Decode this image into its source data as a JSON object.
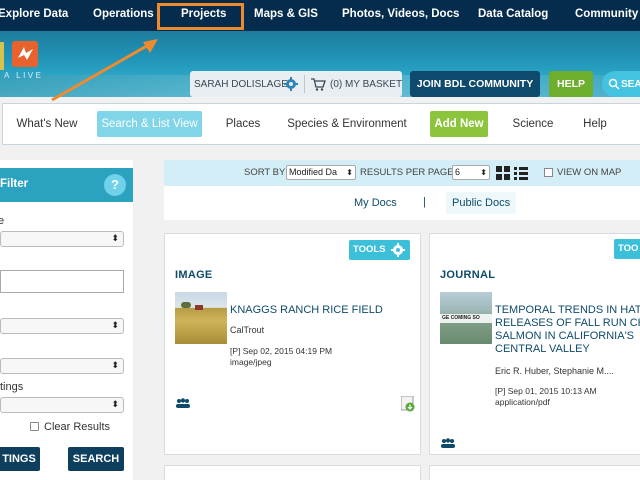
{
  "topnav": {
    "items": [
      "Explore Data",
      "Operations",
      "Projects",
      "Maps & GIS",
      "Photos, Videos, Docs",
      "Data Catalog",
      "Community"
    ]
  },
  "banner": {
    "logo_text": "A LIVE",
    "user_name": "SARAH DOLISLAGER",
    "basket": "(0) MY BASKET",
    "join_label": "JOIN BDL COMMUNITY",
    "help_label": "HELP",
    "search_label": "SEA"
  },
  "subnav": {
    "items": [
      "What's New",
      "Search & List View",
      "Places",
      "Species & Environment",
      "Add New",
      "Science",
      "Help"
    ]
  },
  "filter": {
    "title": "Filter",
    "help_glyph": "?",
    "labels": [
      "e",
      "",
      "",
      "",
      "tings"
    ],
    "clear_label": "Clear Results",
    "btn_settings": "TINGS",
    "btn_search": "SEARCH"
  },
  "sortbar": {
    "sort_by_label": "SORT BY",
    "sort_value": "Modified Da",
    "per_page_label": "RESULTS PER PAGE",
    "per_page_value": "6",
    "view_on_map_label": "VIEW ON MAP"
  },
  "docs": {
    "my_docs": "My Docs",
    "separator": "|",
    "public_docs": "Public Docs"
  },
  "cards": [
    {
      "tools": "TOOLS",
      "type": "IMAGE",
      "title": "KNAGGS RANCH RICE FIELD",
      "author": "CalTrout",
      "date": "[P] Sep 02, 2015 04:19 PM",
      "mime": "image/jpeg"
    },
    {
      "tools": "TOOLS",
      "type": "JOURNAL",
      "title_lines": [
        "TEMPORAL TRENDS IN HAT",
        "RELEASES OF FALL RUN CHI",
        "SALMON IN CALIFORNIA'S",
        "CENTRAL VALLEY"
      ],
      "thumb_text": "GE COMING SO",
      "author": "Eric R. Huber, Stephanie M....",
      "date": "[P] Sep 01, 2015 10:13 AM",
      "mime": "application/pdf"
    },
    {
      "tools": "TOO"
    }
  ],
  "colors": {
    "nav_bg": "#052c4d",
    "highlight": "#f08a2e",
    "teal": "#2ca2c1",
    "green": "#8cc43c",
    "dark_btn": "#0f3f5e"
  }
}
